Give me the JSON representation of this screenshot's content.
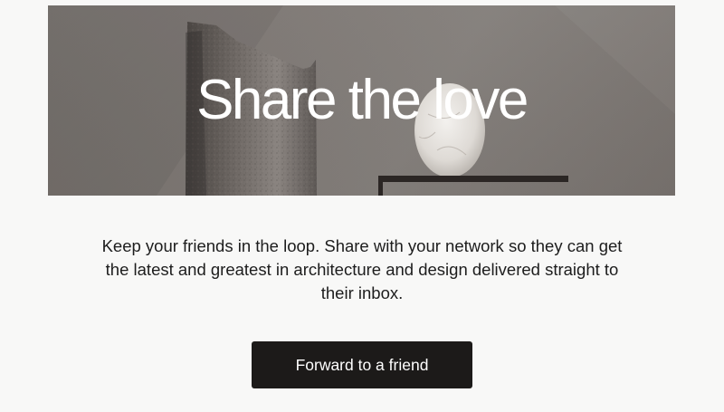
{
  "hero": {
    "title": "Share the love"
  },
  "body": {
    "text": "Keep your friends in the loop. Share with your network so they can get the latest and greatest in architecture and design delivered straight to their inbox."
  },
  "cta": {
    "label": "Forward to a friend"
  },
  "colors": {
    "page_background": "#f8f8f7",
    "hero_background": "#7c7672",
    "button_background": "#1c1a19",
    "button_text": "#ffffff",
    "body_text": "#1d1d1d"
  }
}
